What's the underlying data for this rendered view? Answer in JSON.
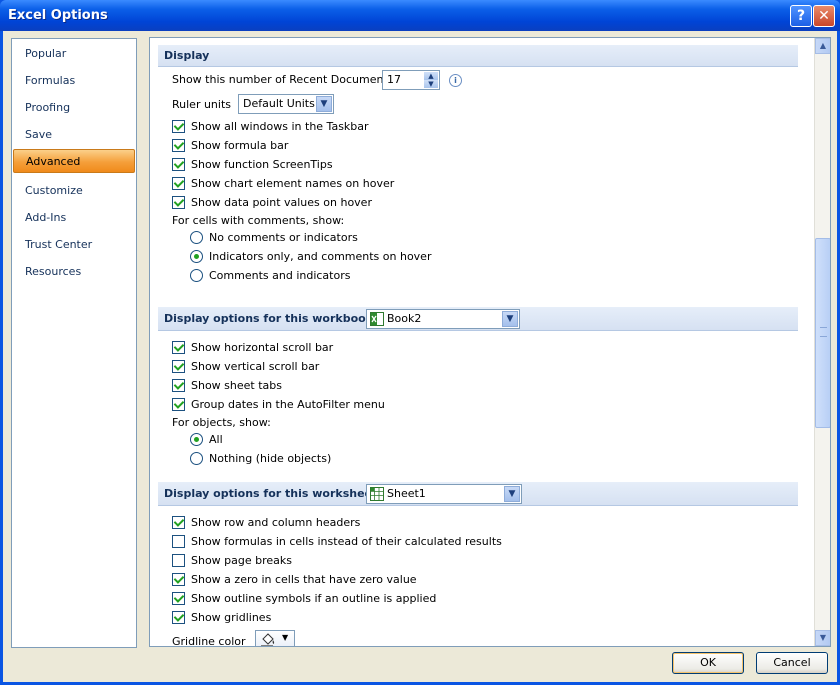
{
  "window": {
    "title": "Excel Options",
    "help_label": "?",
    "close_label": "✕"
  },
  "nav": {
    "items": [
      {
        "label": "Popular",
        "active": false
      },
      {
        "label": "Formulas",
        "active": false
      },
      {
        "label": "Proofing",
        "active": false
      },
      {
        "label": "Save",
        "active": false
      },
      {
        "label": "Advanced",
        "active": true
      },
      {
        "label": "Customize",
        "active": false
      },
      {
        "label": "Add-Ins",
        "active": false
      },
      {
        "label": "Trust Center",
        "active": false
      },
      {
        "label": "Resources",
        "active": false
      }
    ]
  },
  "display": {
    "header": "Display",
    "recent_docs_label": "Show this number of Recent Documents:",
    "recent_docs_value": "17",
    "ruler_units_label": "Ruler units",
    "ruler_units_value": "Default Units",
    "checkboxes": [
      {
        "label": "Show all windows in the Taskbar",
        "checked": true
      },
      {
        "label": "Show formula bar",
        "checked": true
      },
      {
        "label": "Show function ScreenTips",
        "checked": true
      },
      {
        "label": "Show chart element names on hover",
        "checked": true
      },
      {
        "label": "Show data point values on hover",
        "checked": true
      }
    ],
    "comments_label": "For cells with comments, show:",
    "comments_options": [
      {
        "label": "No comments or indicators",
        "checked": false
      },
      {
        "label": "Indicators only, and comments on hover",
        "checked": true
      },
      {
        "label": "Comments and indicators",
        "checked": false
      }
    ]
  },
  "workbook": {
    "header": "Display options for this workbook:",
    "selected": "Book2",
    "checkboxes": [
      {
        "label": "Show horizontal scroll bar",
        "checked": true
      },
      {
        "label": "Show vertical scroll bar",
        "checked": true
      },
      {
        "label": "Show sheet tabs",
        "checked": true
      },
      {
        "label": "Group dates in the AutoFilter menu",
        "checked": true
      }
    ],
    "objects_label": "For objects, show:",
    "objects_options": [
      {
        "label": "All",
        "checked": true
      },
      {
        "label": "Nothing (hide objects)",
        "checked": false
      }
    ]
  },
  "worksheet": {
    "header": "Display options for this worksheet:",
    "selected": "Sheet1",
    "checkboxes": [
      {
        "label": "Show row and column headers",
        "checked": true
      },
      {
        "label": "Show formulas in cells instead of their calculated results",
        "checked": false
      },
      {
        "label": "Show page breaks",
        "checked": false
      },
      {
        "label": "Show a zero in cells that have zero value",
        "checked": true
      },
      {
        "label": "Show outline symbols if an outline is applied",
        "checked": true
      },
      {
        "label": "Show gridlines",
        "checked": true
      }
    ],
    "gridline_color_label": "Gridline color"
  },
  "buttons": {
    "ok": "OK",
    "cancel": "Cancel"
  },
  "colors": {
    "title_bar": "#0b5fe8",
    "active_nav": "#f59f3a",
    "check": "#21a121",
    "section_header": "#d6e1f2"
  }
}
